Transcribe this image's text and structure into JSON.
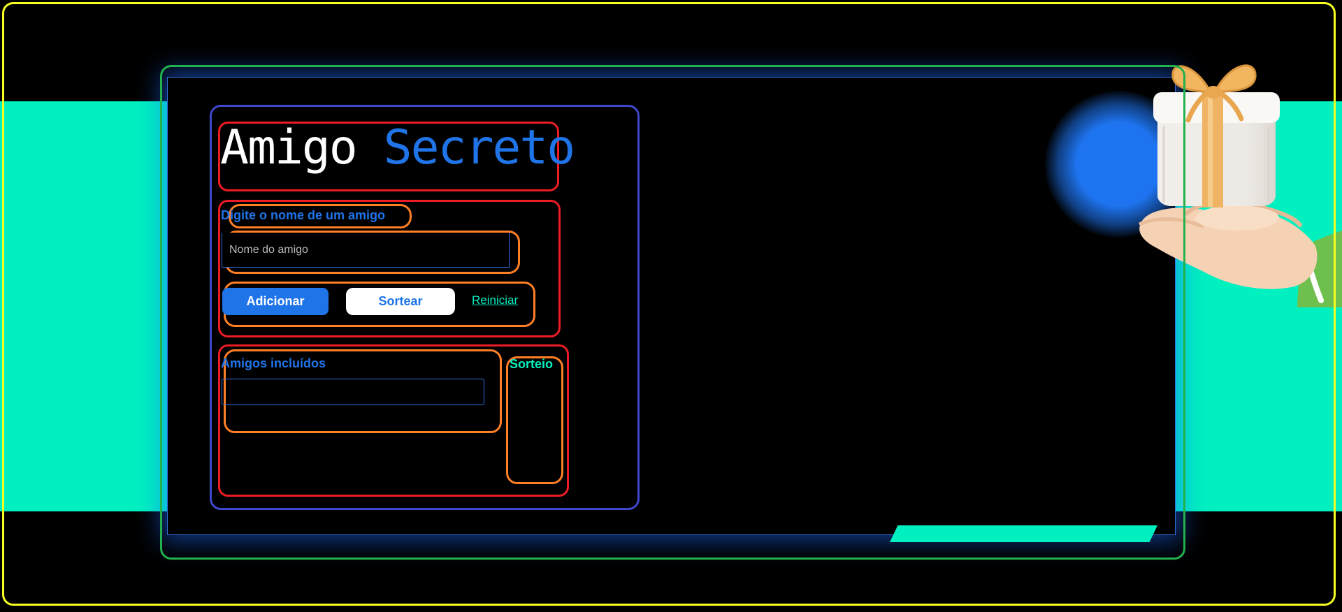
{
  "header": {
    "title_part1": "Amigo",
    "title_part2": "Secreto"
  },
  "form": {
    "label": "Digite o nome de um amigo",
    "input_placeholder": "Nome do amigo",
    "input_value": "",
    "add_button_label": "Adicionar",
    "draw_button_label": "Sortear",
    "reset_link_label": "Reiniciar"
  },
  "lists": {
    "friends_heading": "Amigos incluídos",
    "friends": [],
    "result_heading": "Sorteio",
    "result": []
  },
  "colors": {
    "accent_blue": "#1f74e8",
    "accent_teal": "#00f0c0",
    "background": "#000000",
    "outline_yellow": "#f5ff20",
    "outline_green": "#22b14c",
    "outline_blue": "#3f48cc",
    "outline_red": "#ed1c24",
    "outline_orange": "#ff7f27"
  },
  "icons": {
    "illustration": "gift-on-hand-icon"
  }
}
